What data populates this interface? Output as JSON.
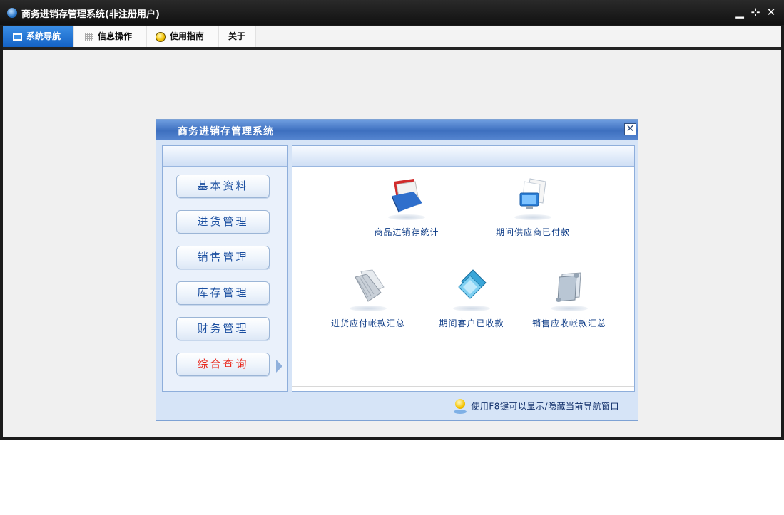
{
  "window": {
    "title": "商务进销存管理系统(非注册用户)",
    "controls": [
      "minimize-icon",
      "restore-icon",
      "close-icon"
    ]
  },
  "tabs": [
    {
      "label": "系统导航",
      "icon": "monitor-icon",
      "active": true
    },
    {
      "label": "信息操作",
      "icon": "grid-icon",
      "active": false
    },
    {
      "label": "使用指南",
      "icon": "bulb-icon",
      "active": false
    },
    {
      "label": "关于",
      "icon": "",
      "active": false
    }
  ],
  "nav_dialog": {
    "title": "商务进销存管理系统",
    "close_glyph": "✕",
    "modules": [
      {
        "label": "基本资料",
        "active": false
      },
      {
        "label": "进货管理",
        "active": false
      },
      {
        "label": "销售管理",
        "active": false
      },
      {
        "label": "库存管理",
        "active": false
      },
      {
        "label": "财务管理",
        "active": false
      },
      {
        "label": "综合查询",
        "active": true
      }
    ],
    "functions": [
      {
        "label": "商品进销存统计",
        "icon": "books-icon"
      },
      {
        "label": "期间供应商已付款",
        "icon": "monitor-docs-icon"
      },
      {
        "label": "进货应付帐款汇总",
        "icon": "folder-icon"
      },
      {
        "label": "期间客户已收款",
        "icon": "cards-icon"
      },
      {
        "label": "销售应收帐款汇总",
        "icon": "scroll-icon"
      }
    ],
    "tip": "使用F8键可以显示/隐藏当前导航窗口"
  },
  "colors": {
    "tab_active": "#1f6fd0",
    "module_text": "#1b4fa0",
    "module_active_text": "#e8281d",
    "dialog_title_bar": "#4a7ac8"
  }
}
